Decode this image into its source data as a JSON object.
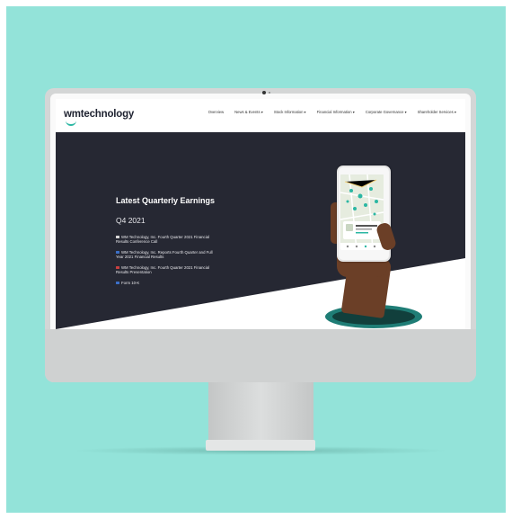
{
  "logo": {
    "prefix": "wm",
    "suffix": "technology"
  },
  "nav": {
    "items": [
      {
        "label": "Overview"
      },
      {
        "label": "News & Events ▾"
      },
      {
        "label": "Stock Information ▾"
      },
      {
        "label": "Financial Information ▾"
      },
      {
        "label": "Corporate Governance ▾"
      },
      {
        "label": "Shareholder Services ▾"
      }
    ]
  },
  "hero": {
    "title": "Latest Quarterly Earnings",
    "period": "Q4  2021",
    "links": [
      {
        "label": "WM Technology, Inc. Fourth Quarter 2021 Financial Results Conference Call",
        "icon": "audio-icon",
        "icon_color": "#d8d8d8"
      },
      {
        "label": "WM Technology, Inc. Reports Fourth Quarter and Full Year 2021 Financial Results",
        "icon": "document-icon",
        "icon_color": "#3b6fc7"
      },
      {
        "label": "WM Technology, Inc. Fourth Quarter 2021 Financial Results Presentation",
        "icon": "pdf-icon",
        "icon_color": "#c94040"
      },
      {
        "label": "Form 10-K",
        "icon": "document-icon",
        "icon_color": "#3b6fc7"
      }
    ]
  },
  "colors": {
    "background": "#93e3d9",
    "hero_dark": "#262833",
    "accent": "#2bb7a3"
  }
}
